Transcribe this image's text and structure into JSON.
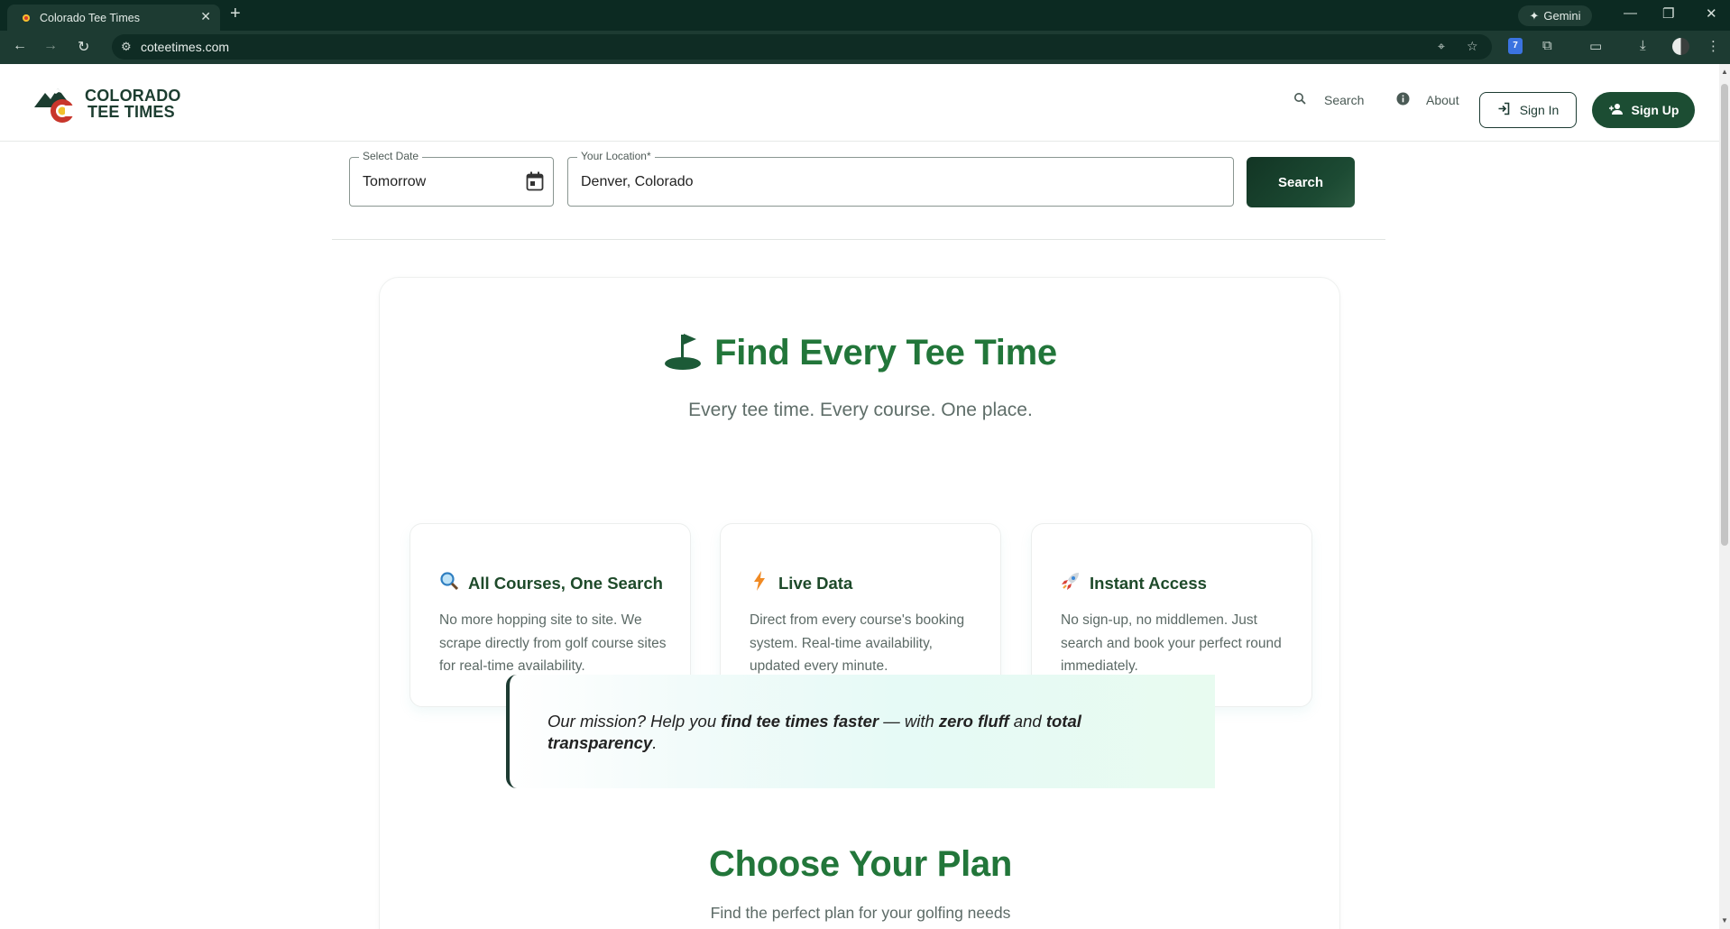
{
  "browser": {
    "tab_title": "Colorado Tee Times",
    "tab_close": "✕",
    "new_tab": "+",
    "gemini_label": "Gemini",
    "url": "coteetimes.com",
    "extension_badge": "7"
  },
  "header": {
    "logo_line1": "COLORADO",
    "logo_line2": "TEE TIMES",
    "nav_search": "Search",
    "nav_about": "About",
    "sign_in": "Sign In",
    "sign_up": "Sign Up"
  },
  "search_bar": {
    "date_label": "Select Date",
    "date_value": "Tomorrow",
    "location_label": "Your Location*",
    "location_value": "Denver, Colorado",
    "search_button": "Search"
  },
  "hero": {
    "title": "Find Every Tee Time",
    "subtitle": "Every tee time. Every course. One place."
  },
  "features": [
    {
      "icon": "magnifier-icon",
      "title": "All Courses, One Search",
      "text": "No more hopping site to site. We scrape directly from golf course sites for real-time availability."
    },
    {
      "icon": "lightning-icon",
      "title": "Live Data",
      "text": "Direct from every course's booking system. Real-time availability, updated every minute."
    },
    {
      "icon": "rocket-icon",
      "title": "Instant Access",
      "text": "No sign-up, no middlemen. Just search and book your perfect round immediately."
    }
  ],
  "mission": {
    "lead": "Our mission? Help you ",
    "bold1": "find tee times faster",
    "mid1": " — with ",
    "bold2": "zero fluff",
    "mid2": " and ",
    "bold3": "total transparency",
    "end": "."
  },
  "plans": {
    "title": "Choose Your Plan",
    "subtitle": "Find the perfect plan for your golfing needs"
  },
  "colors": {
    "brand_dark": "#1d3b32",
    "brand_green": "#22763a",
    "browser_frame": "#0c2a22"
  }
}
